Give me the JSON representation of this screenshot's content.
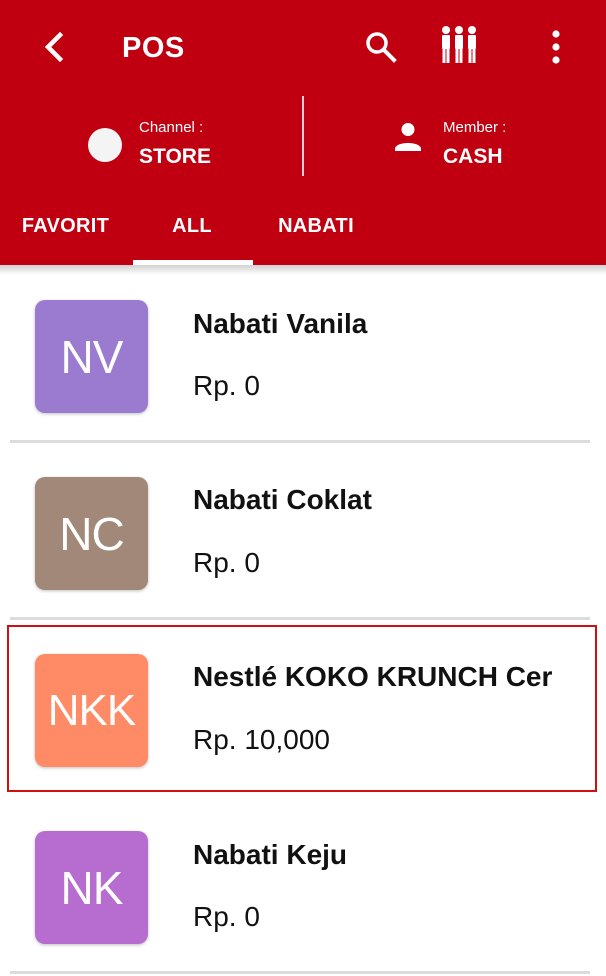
{
  "toolbar": {
    "title": "POS",
    "back_icon": "back-arrow-icon",
    "search_icon": "search-icon",
    "members_icon": "people-group-icon",
    "more_icon": "more-vertical-icon"
  },
  "info": {
    "channel_label": "Channel :",
    "channel_value": "STORE",
    "member_label": "Member :",
    "member_value": "CASH"
  },
  "tabs": [
    {
      "label": "FAVORIT",
      "active": false
    },
    {
      "label": "ALL",
      "active": true
    },
    {
      "label": "NABATI",
      "active": false
    }
  ],
  "products": [
    {
      "initials": "NV",
      "name": "Nabati Vanila",
      "price": "Rp. 0",
      "color": "#9a7bd0"
    },
    {
      "initials": "NC",
      "name": "Nabati Coklat",
      "price": "Rp. 0",
      "color": "#a18878"
    },
    {
      "initials": "NKK",
      "name": "Nestlé KOKO KRUNCH Cer",
      "price": "Rp. 10,000",
      "color": "#ff8a66",
      "highlighted": true
    },
    {
      "initials": "NK",
      "name": "Nabati Keju",
      "price": "Rp. 0",
      "color": "#b76ccf"
    }
  ],
  "colors": {
    "header_bg": "#c00010",
    "highlight_border": "#d01010"
  }
}
